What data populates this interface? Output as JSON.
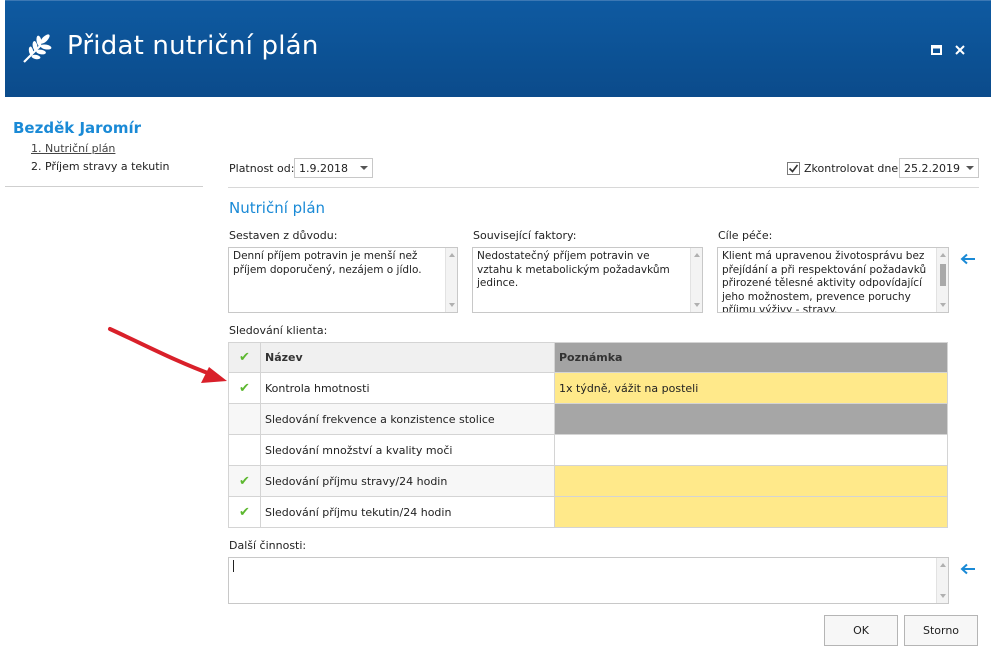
{
  "window": {
    "title": "Přidat nutriční plán",
    "icon": "wheat-icon",
    "controls": [
      "maximize-icon",
      "close-icon"
    ]
  },
  "sidebar": {
    "patient_name": "Bezděk Jaromír",
    "items": [
      {
        "label": "1. Nutriční plán",
        "active": true
      },
      {
        "label": "2. Příjem stravy a tekutin",
        "active": false
      }
    ]
  },
  "form": {
    "validity_label": "Platnost od:",
    "validity_value": "1.9.2018",
    "check_label": "Zkontrolovat dne:",
    "check_checked": true,
    "check_value": "25.2.2019",
    "section_title": "Nutriční plán",
    "reason_label": "Sestaven z důvodu:",
    "reason_text": "Denní příjem potravin je menší než příjem doporučený, nezájem o jídlo.",
    "factors_label": "Související faktory:",
    "factors_text": "Nedostatečný příjem potravin ve vztahu k metabolickým požadavkům jedince.",
    "goals_label": "Cíle péče:",
    "goals_text": "Klient má upravenou životosprávu bez přejídání a při respektování požadavků přirozené tělesné aktivity odpovídající jeho možnostem, prevence poruchy příjmu výživy - stravy.",
    "monitoring_label": "Sledování klienta:",
    "other_label": "Další činnosti:",
    "other_value": ""
  },
  "table": {
    "columns": [
      "Název",
      "Poznámka"
    ],
    "header_check": true,
    "rows": [
      {
        "checked": true,
        "name": "Kontrola hmotnosti",
        "note": "1x týdně, vážit na posteli",
        "note_style": "yellow"
      },
      {
        "checked": false,
        "name": "Sledování frekvence a konzistence stolice",
        "note": "",
        "note_style": "gray"
      },
      {
        "checked": false,
        "name": "Sledování množství a kvality moči",
        "note": "",
        "note_style": "white"
      },
      {
        "checked": true,
        "name": "Sledování příjmu stravy/24 hodin",
        "note": "",
        "note_style": "yellow"
      },
      {
        "checked": true,
        "name": "Sledování příjmu tekutin/24 hodin",
        "note": "",
        "note_style": "yellow"
      }
    ]
  },
  "buttons": {
    "ok": "OK",
    "cancel": "Storno"
  },
  "colors": {
    "titlebar": "#0b4b8b",
    "accent": "#1a8ad6",
    "highlight": "#ffe98a",
    "check": "#5cb82f",
    "annotation_arrow": "#d9202a"
  },
  "tick_glyph": "✔"
}
